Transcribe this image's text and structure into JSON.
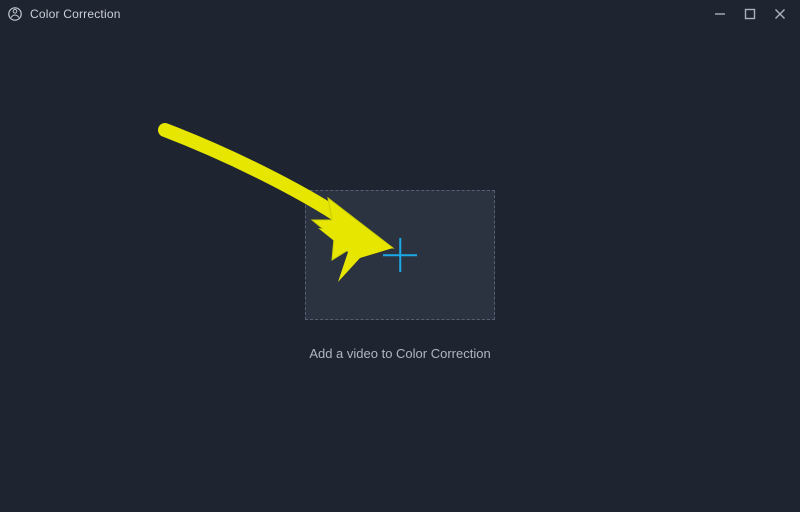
{
  "window": {
    "title": "Color Correction",
    "app_icon": "app-circle-icon"
  },
  "dropzone": {
    "plus_icon": "plus-icon",
    "caption": "Add a video to Color Correction",
    "accent_color": "#1aa9e6"
  },
  "annotation": {
    "arrow_color": "#e6e600",
    "description": "yellow arrow pointing to plus button"
  }
}
